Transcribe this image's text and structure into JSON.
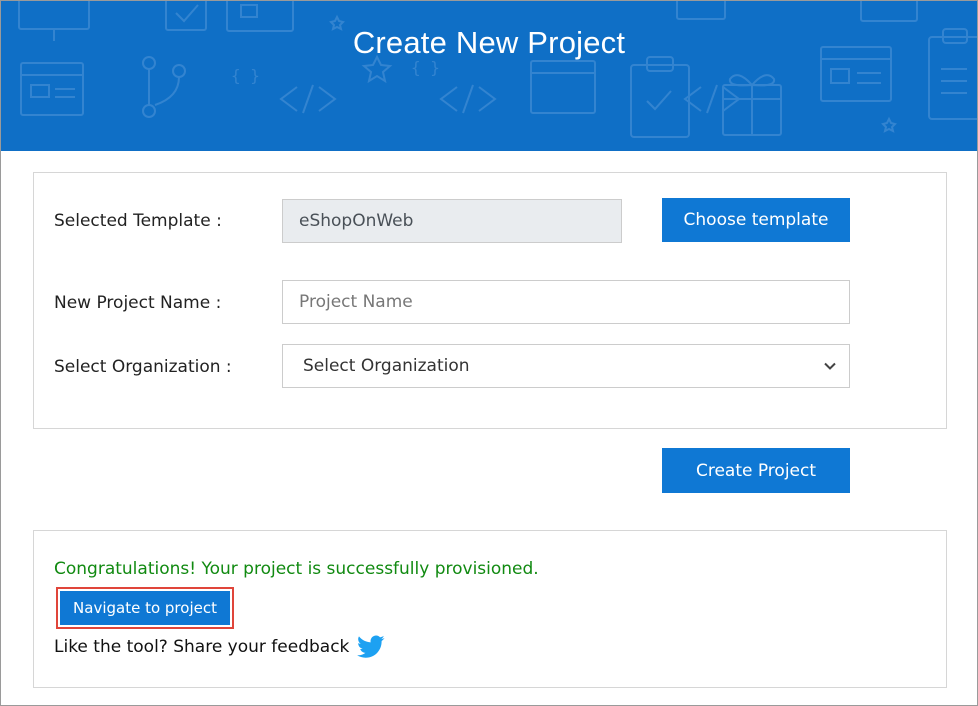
{
  "header": {
    "title": "Create New Project",
    "background_color": "#0f6fc6"
  },
  "form": {
    "template_label": "Selected Template :",
    "template_value": "eShopOnWeb",
    "choose_template_label": "Choose template",
    "project_name_label": "New Project Name :",
    "project_name_placeholder": "Project Name",
    "project_name_value": "",
    "organization_label": "Select Organization :",
    "organization_selected": "Select Organization",
    "organization_icon": "chevron-down-icon"
  },
  "actions": {
    "create_label": "Create Project",
    "button_color": "#0f78d4"
  },
  "result": {
    "success_message": "Congratulations! Your project is successfully provisioned.",
    "success_color": "#118a11",
    "navigate_label": "Navigate to project",
    "highlight_color": "#e0453a",
    "feedback_text": "Like the tool? Share your feedback",
    "feedback_icon": "twitter-icon",
    "twitter_color": "#1da1f2"
  }
}
